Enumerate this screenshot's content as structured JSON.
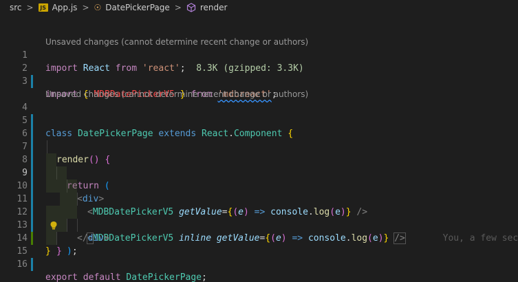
{
  "breadcrumbs": {
    "items": [
      {
        "label": "src"
      },
      {
        "label": "App.js",
        "icon": "js-file-icon"
      },
      {
        "label": "DatePickerPage",
        "icon": "component-icon"
      },
      {
        "label": "render",
        "icon": "method-cube-icon"
      }
    ],
    "separator": ">",
    "js_badge": "JS"
  },
  "codelens": {
    "top": "Unsaved changes (cannot determine recent change or authors)",
    "class": "Unsaved changes (cannot determine recent change or authors)"
  },
  "line_numbers": [
    "1",
    "2",
    "3",
    "4",
    "5",
    "6",
    "7",
    "8",
    "9",
    "10",
    "11",
    "12",
    "13",
    "14",
    "15",
    "16"
  ],
  "code": {
    "l1": {
      "import": "import",
      "react": "React",
      "from": "from",
      "module": "'react'",
      "semi": ";",
      "hint": "8.3K (gzipped: 3.3K)"
    },
    "l2": {
      "import": "import",
      "lbrace": "{",
      "name": "MDBDatePickerV5",
      "rbrace": "}",
      "from": "from",
      "module": "'mdbreact'",
      "semi": ";"
    },
    "l4": {
      "class": "class",
      "name": "DatePickerPage",
      "extends": "extends",
      "react": "React",
      "dot": ".",
      "component": "Component",
      "brace": "{"
    },
    "l5": {
      "fn": "render",
      "parens": "()",
      "brace": "{"
    },
    "l6": {
      "return": "return",
      "paren": "("
    },
    "l7": {
      "open": "<",
      "tag": "div",
      "close": ">"
    },
    "l8": {
      "open": "<",
      "tag": "MDBDatePickerV5",
      "attr": "getValue",
      "eq": "=",
      "lbrace": "{",
      "lparen": "(",
      "param": "e",
      "rparen": ")",
      "arrow": "=>",
      "console": "console",
      "dot": ".",
      "log": "log",
      "argopen": "(",
      "arg": "e",
      "argclose": ")",
      "rbrace": "}",
      "selfclose": "/>"
    },
    "l9": {
      "open": "<",
      "tag": "MDBDatePickerV5",
      "attr_inline": "inline",
      "attr": "getValue",
      "eq": "=",
      "lbrace": "{",
      "lparen": "(",
      "param": "e",
      "rparen": ")",
      "arrow": "=>",
      "console": "console",
      "dot": ".",
      "log": "log",
      "argopen": "(",
      "arg": "e",
      "argclose": ")",
      "rbrace": "}",
      "selfclose": "/>",
      "blame": "You, a few secon"
    },
    "l10": {
      "open": "</",
      "tag": "div",
      "close": ">"
    },
    "l11": {
      "paren": ")",
      "semi": ";"
    },
    "l12": {
      "brace": "}"
    },
    "l13": {
      "brace": "}"
    },
    "l15": {
      "export": "export",
      "default": "default",
      "name": "DatePickerPage",
      "semi": ";"
    }
  },
  "colors": {
    "background": "#1e1e1e",
    "modified_bar": "#1b81a8",
    "added_bar": "#487e02",
    "lightbulb": "#ffcc00"
  }
}
